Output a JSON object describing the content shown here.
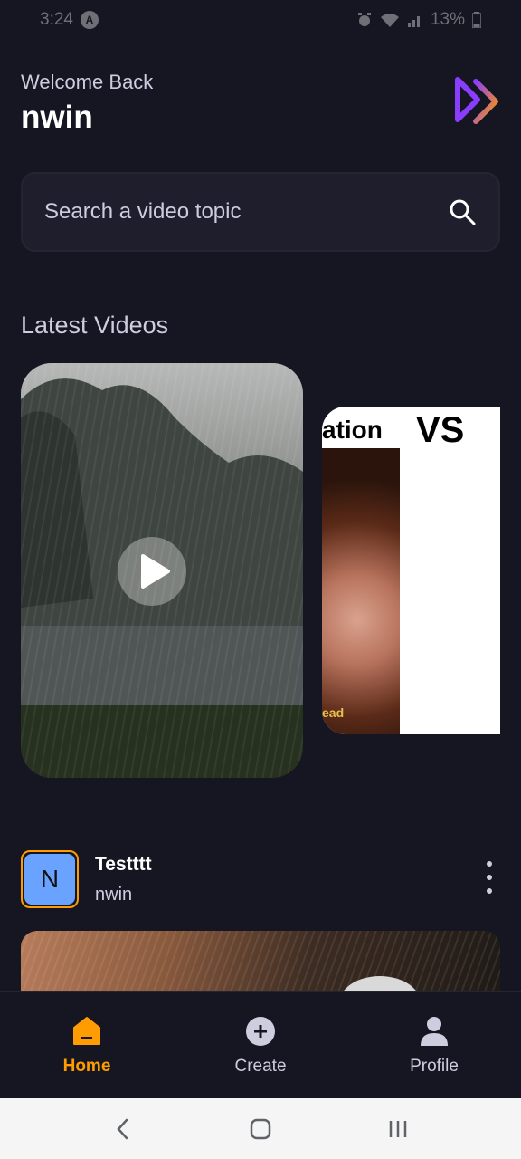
{
  "status_bar": {
    "time": "3:24",
    "notification_badge": "A",
    "battery": "13%"
  },
  "header": {
    "welcome": "Welcome Back",
    "username": "nwin"
  },
  "search": {
    "placeholder": "Search a video topic"
  },
  "latest": {
    "title": "Latest Videos",
    "second_card": {
      "top_text": "ation",
      "vs_text": "VS",
      "caption": "ead"
    }
  },
  "post": {
    "avatar_letter": "N",
    "title": "Testttt",
    "author": "nwin"
  },
  "tabs": [
    {
      "label": "Home",
      "icon": "home-icon",
      "active": true
    },
    {
      "label": "Create",
      "icon": "plus-circle-icon",
      "active": false
    },
    {
      "label": "Profile",
      "icon": "profile-icon",
      "active": false
    }
  ],
  "colors": {
    "background": "#161622",
    "accent": "#ff9c01",
    "text_secondary": "#cdcde0",
    "surface": "#1e1e2d"
  }
}
